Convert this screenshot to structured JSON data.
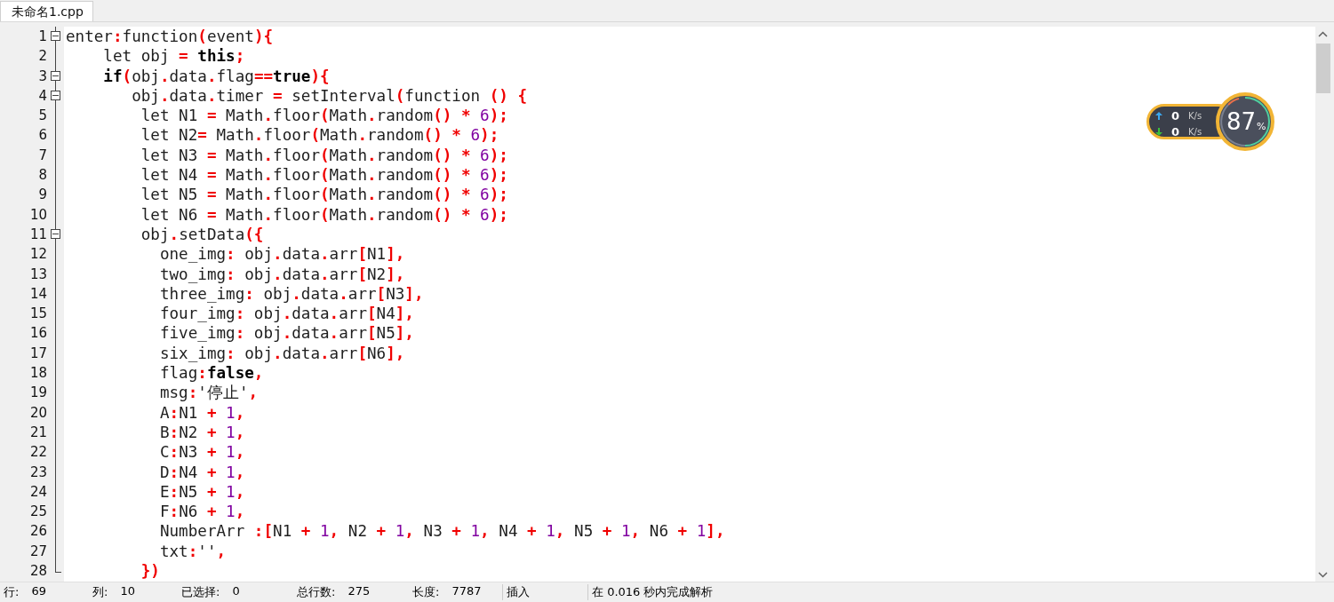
{
  "tabs": [
    {
      "label": "未命名1.cpp",
      "selected": true
    }
  ],
  "editor": {
    "lines": [
      {
        "number": "1",
        "fold_start": true,
        "tokens": [
          {
            "kind": "text",
            "text": "enter"
          },
          {
            "kind": "op",
            "text": ":"
          },
          {
            "kind": "text",
            "text": "function"
          },
          {
            "kind": "op",
            "text": "("
          },
          {
            "kind": "text",
            "text": "event"
          },
          {
            "kind": "op",
            "text": "){"
          }
        ]
      },
      {
        "number": "2",
        "tokens": [
          {
            "kind": "text",
            "text": "    let obj "
          },
          {
            "kind": "op",
            "text": "= "
          },
          {
            "kind": "keyword",
            "text": "this"
          },
          {
            "kind": "op",
            "text": ";"
          }
        ]
      },
      {
        "number": "3",
        "fold_start": true,
        "tokens": [
          {
            "kind": "keyword",
            "text": "    if"
          },
          {
            "kind": "op",
            "text": "("
          },
          {
            "kind": "text",
            "text": "obj"
          },
          {
            "kind": "op",
            "text": "."
          },
          {
            "kind": "text",
            "text": "data"
          },
          {
            "kind": "op",
            "text": "."
          },
          {
            "kind": "text",
            "text": "flag"
          },
          {
            "kind": "op",
            "text": "=="
          },
          {
            "kind": "keyword",
            "text": "true"
          },
          {
            "kind": "op",
            "text": "){"
          }
        ]
      },
      {
        "number": "4",
        "fold_start": true,
        "tokens": [
          {
            "kind": "text",
            "text": "       obj"
          },
          {
            "kind": "op",
            "text": "."
          },
          {
            "kind": "text",
            "text": "data"
          },
          {
            "kind": "op",
            "text": "."
          },
          {
            "kind": "text",
            "text": "timer "
          },
          {
            "kind": "op",
            "text": "="
          },
          {
            "kind": "text",
            "text": " setInterval"
          },
          {
            "kind": "op",
            "text": "("
          },
          {
            "kind": "text",
            "text": "function "
          },
          {
            "kind": "op",
            "text": "() {"
          }
        ]
      },
      {
        "number": "5",
        "tokens": [
          {
            "kind": "text",
            "text": "        let N1 "
          },
          {
            "kind": "op",
            "text": "="
          },
          {
            "kind": "text",
            "text": " Math"
          },
          {
            "kind": "op",
            "text": "."
          },
          {
            "kind": "text",
            "text": "floor"
          },
          {
            "kind": "op",
            "text": "("
          },
          {
            "kind": "text",
            "text": "Math"
          },
          {
            "kind": "op",
            "text": "."
          },
          {
            "kind": "text",
            "text": "random"
          },
          {
            "kind": "op",
            "text": "() * "
          },
          {
            "kind": "number",
            "text": "6"
          },
          {
            "kind": "op",
            "text": ");"
          }
        ]
      },
      {
        "number": "6",
        "tokens": [
          {
            "kind": "text",
            "text": "        let N2"
          },
          {
            "kind": "op",
            "text": "="
          },
          {
            "kind": "text",
            "text": " Math"
          },
          {
            "kind": "op",
            "text": "."
          },
          {
            "kind": "text",
            "text": "floor"
          },
          {
            "kind": "op",
            "text": "("
          },
          {
            "kind": "text",
            "text": "Math"
          },
          {
            "kind": "op",
            "text": "."
          },
          {
            "kind": "text",
            "text": "random"
          },
          {
            "kind": "op",
            "text": "() * "
          },
          {
            "kind": "number",
            "text": "6"
          },
          {
            "kind": "op",
            "text": ");"
          }
        ]
      },
      {
        "number": "7",
        "tokens": [
          {
            "kind": "text",
            "text": "        let N3 "
          },
          {
            "kind": "op",
            "text": "="
          },
          {
            "kind": "text",
            "text": " Math"
          },
          {
            "kind": "op",
            "text": "."
          },
          {
            "kind": "text",
            "text": "floor"
          },
          {
            "kind": "op",
            "text": "("
          },
          {
            "kind": "text",
            "text": "Math"
          },
          {
            "kind": "op",
            "text": "."
          },
          {
            "kind": "text",
            "text": "random"
          },
          {
            "kind": "op",
            "text": "() * "
          },
          {
            "kind": "number",
            "text": "6"
          },
          {
            "kind": "op",
            "text": ");"
          }
        ]
      },
      {
        "number": "8",
        "tokens": [
          {
            "kind": "text",
            "text": "        let N4 "
          },
          {
            "kind": "op",
            "text": "="
          },
          {
            "kind": "text",
            "text": " Math"
          },
          {
            "kind": "op",
            "text": "."
          },
          {
            "kind": "text",
            "text": "floor"
          },
          {
            "kind": "op",
            "text": "("
          },
          {
            "kind": "text",
            "text": "Math"
          },
          {
            "kind": "op",
            "text": "."
          },
          {
            "kind": "text",
            "text": "random"
          },
          {
            "kind": "op",
            "text": "() * "
          },
          {
            "kind": "number",
            "text": "6"
          },
          {
            "kind": "op",
            "text": ");"
          }
        ]
      },
      {
        "number": "9",
        "tokens": [
          {
            "kind": "text",
            "text": "        let N5 "
          },
          {
            "kind": "op",
            "text": "="
          },
          {
            "kind": "text",
            "text": " Math"
          },
          {
            "kind": "op",
            "text": "."
          },
          {
            "kind": "text",
            "text": "floor"
          },
          {
            "kind": "op",
            "text": "("
          },
          {
            "kind": "text",
            "text": "Math"
          },
          {
            "kind": "op",
            "text": "."
          },
          {
            "kind": "text",
            "text": "random"
          },
          {
            "kind": "op",
            "text": "() * "
          },
          {
            "kind": "number",
            "text": "6"
          },
          {
            "kind": "op",
            "text": ");"
          }
        ]
      },
      {
        "number": "10",
        "tokens": [
          {
            "kind": "text",
            "text": "        let N6 "
          },
          {
            "kind": "op",
            "text": "="
          },
          {
            "kind": "text",
            "text": " Math"
          },
          {
            "kind": "op",
            "text": "."
          },
          {
            "kind": "text",
            "text": "floor"
          },
          {
            "kind": "op",
            "text": "("
          },
          {
            "kind": "text",
            "text": "Math"
          },
          {
            "kind": "op",
            "text": "."
          },
          {
            "kind": "text",
            "text": "random"
          },
          {
            "kind": "op",
            "text": "() * "
          },
          {
            "kind": "number",
            "text": "6"
          },
          {
            "kind": "op",
            "text": ");"
          }
        ]
      },
      {
        "number": "11",
        "fold_start": true,
        "tokens": [
          {
            "kind": "text",
            "text": "        obj"
          },
          {
            "kind": "op",
            "text": "."
          },
          {
            "kind": "text",
            "text": "setData"
          },
          {
            "kind": "op",
            "text": "({"
          }
        ]
      },
      {
        "number": "12",
        "tokens": [
          {
            "kind": "text",
            "text": "          one_img"
          },
          {
            "kind": "op",
            "text": ":"
          },
          {
            "kind": "text",
            "text": " obj"
          },
          {
            "kind": "op",
            "text": "."
          },
          {
            "kind": "text",
            "text": "data"
          },
          {
            "kind": "op",
            "text": "."
          },
          {
            "kind": "text",
            "text": "arr"
          },
          {
            "kind": "op",
            "text": "["
          },
          {
            "kind": "text",
            "text": "N1"
          },
          {
            "kind": "op",
            "text": "],"
          }
        ]
      },
      {
        "number": "13",
        "tokens": [
          {
            "kind": "text",
            "text": "          two_img"
          },
          {
            "kind": "op",
            "text": ":"
          },
          {
            "kind": "text",
            "text": " obj"
          },
          {
            "kind": "op",
            "text": "."
          },
          {
            "kind": "text",
            "text": "data"
          },
          {
            "kind": "op",
            "text": "."
          },
          {
            "kind": "text",
            "text": "arr"
          },
          {
            "kind": "op",
            "text": "["
          },
          {
            "kind": "text",
            "text": "N2"
          },
          {
            "kind": "op",
            "text": "],"
          }
        ]
      },
      {
        "number": "14",
        "tokens": [
          {
            "kind": "text",
            "text": "          three_img"
          },
          {
            "kind": "op",
            "text": ":"
          },
          {
            "kind": "text",
            "text": " obj"
          },
          {
            "kind": "op",
            "text": "."
          },
          {
            "kind": "text",
            "text": "data"
          },
          {
            "kind": "op",
            "text": "."
          },
          {
            "kind": "text",
            "text": "arr"
          },
          {
            "kind": "op",
            "text": "["
          },
          {
            "kind": "text",
            "text": "N3"
          },
          {
            "kind": "op",
            "text": "],"
          }
        ]
      },
      {
        "number": "15",
        "tokens": [
          {
            "kind": "text",
            "text": "          four_img"
          },
          {
            "kind": "op",
            "text": ":"
          },
          {
            "kind": "text",
            "text": " obj"
          },
          {
            "kind": "op",
            "text": "."
          },
          {
            "kind": "text",
            "text": "data"
          },
          {
            "kind": "op",
            "text": "."
          },
          {
            "kind": "text",
            "text": "arr"
          },
          {
            "kind": "op",
            "text": "["
          },
          {
            "kind": "text",
            "text": "N4"
          },
          {
            "kind": "op",
            "text": "],"
          }
        ]
      },
      {
        "number": "16",
        "tokens": [
          {
            "kind": "text",
            "text": "          five_img"
          },
          {
            "kind": "op",
            "text": ":"
          },
          {
            "kind": "text",
            "text": " obj"
          },
          {
            "kind": "op",
            "text": "."
          },
          {
            "kind": "text",
            "text": "data"
          },
          {
            "kind": "op",
            "text": "."
          },
          {
            "kind": "text",
            "text": "arr"
          },
          {
            "kind": "op",
            "text": "["
          },
          {
            "kind": "text",
            "text": "N5"
          },
          {
            "kind": "op",
            "text": "],"
          }
        ]
      },
      {
        "number": "17",
        "tokens": [
          {
            "kind": "text",
            "text": "          six_img"
          },
          {
            "kind": "op",
            "text": ":"
          },
          {
            "kind": "text",
            "text": " obj"
          },
          {
            "kind": "op",
            "text": "."
          },
          {
            "kind": "text",
            "text": "data"
          },
          {
            "kind": "op",
            "text": "."
          },
          {
            "kind": "text",
            "text": "arr"
          },
          {
            "kind": "op",
            "text": "["
          },
          {
            "kind": "text",
            "text": "N6"
          },
          {
            "kind": "op",
            "text": "],"
          }
        ]
      },
      {
        "number": "18",
        "tokens": [
          {
            "kind": "text",
            "text": "          flag"
          },
          {
            "kind": "op",
            "text": ":"
          },
          {
            "kind": "keyword",
            "text": "false"
          },
          {
            "kind": "op",
            "text": ","
          }
        ]
      },
      {
        "number": "19",
        "tokens": [
          {
            "kind": "text",
            "text": "          msg"
          },
          {
            "kind": "op",
            "text": ":"
          },
          {
            "kind": "text",
            "text": "'停止'"
          },
          {
            "kind": "op",
            "text": ","
          }
        ]
      },
      {
        "number": "20",
        "tokens": [
          {
            "kind": "text",
            "text": "          A"
          },
          {
            "kind": "op",
            "text": ":"
          },
          {
            "kind": "text",
            "text": "N1 "
          },
          {
            "kind": "op",
            "text": "+ "
          },
          {
            "kind": "number",
            "text": "1"
          },
          {
            "kind": "op",
            "text": ","
          }
        ]
      },
      {
        "number": "21",
        "tokens": [
          {
            "kind": "text",
            "text": "          B"
          },
          {
            "kind": "op",
            "text": ":"
          },
          {
            "kind": "text",
            "text": "N2 "
          },
          {
            "kind": "op",
            "text": "+ "
          },
          {
            "kind": "number",
            "text": "1"
          },
          {
            "kind": "op",
            "text": ","
          }
        ]
      },
      {
        "number": "22",
        "tokens": [
          {
            "kind": "text",
            "text": "          C"
          },
          {
            "kind": "op",
            "text": ":"
          },
          {
            "kind": "text",
            "text": "N3 "
          },
          {
            "kind": "op",
            "text": "+ "
          },
          {
            "kind": "number",
            "text": "1"
          },
          {
            "kind": "op",
            "text": ","
          }
        ]
      },
      {
        "number": "23",
        "tokens": [
          {
            "kind": "text",
            "text": "          D"
          },
          {
            "kind": "op",
            "text": ":"
          },
          {
            "kind": "text",
            "text": "N4 "
          },
          {
            "kind": "op",
            "text": "+ "
          },
          {
            "kind": "number",
            "text": "1"
          },
          {
            "kind": "op",
            "text": ","
          }
        ]
      },
      {
        "number": "24",
        "tokens": [
          {
            "kind": "text",
            "text": "          E"
          },
          {
            "kind": "op",
            "text": ":"
          },
          {
            "kind": "text",
            "text": "N5 "
          },
          {
            "kind": "op",
            "text": "+ "
          },
          {
            "kind": "number",
            "text": "1"
          },
          {
            "kind": "op",
            "text": ","
          }
        ]
      },
      {
        "number": "25",
        "tokens": [
          {
            "kind": "text",
            "text": "          F"
          },
          {
            "kind": "op",
            "text": ":"
          },
          {
            "kind": "text",
            "text": "N6 "
          },
          {
            "kind": "op",
            "text": "+ "
          },
          {
            "kind": "number",
            "text": "1"
          },
          {
            "kind": "op",
            "text": ","
          }
        ]
      },
      {
        "number": "26",
        "tokens": [
          {
            "kind": "text",
            "text": "          NumberArr "
          },
          {
            "kind": "op",
            "text": ":["
          },
          {
            "kind": "text",
            "text": "N1 "
          },
          {
            "kind": "op",
            "text": "+ "
          },
          {
            "kind": "number",
            "text": "1"
          },
          {
            "kind": "op",
            "text": ","
          },
          {
            "kind": "text",
            "text": " N2 "
          },
          {
            "kind": "op",
            "text": "+ "
          },
          {
            "kind": "number",
            "text": "1"
          },
          {
            "kind": "op",
            "text": ","
          },
          {
            "kind": "text",
            "text": " N3 "
          },
          {
            "kind": "op",
            "text": "+ "
          },
          {
            "kind": "number",
            "text": "1"
          },
          {
            "kind": "op",
            "text": ","
          },
          {
            "kind": "text",
            "text": " N4 "
          },
          {
            "kind": "op",
            "text": "+ "
          },
          {
            "kind": "number",
            "text": "1"
          },
          {
            "kind": "op",
            "text": ","
          },
          {
            "kind": "text",
            "text": " N5 "
          },
          {
            "kind": "op",
            "text": "+ "
          },
          {
            "kind": "number",
            "text": "1"
          },
          {
            "kind": "op",
            "text": ","
          },
          {
            "kind": "text",
            "text": " N6 "
          },
          {
            "kind": "op",
            "text": "+ "
          },
          {
            "kind": "number",
            "text": "1"
          },
          {
            "kind": "op",
            "text": "],"
          }
        ]
      },
      {
        "number": "27",
        "tokens": [
          {
            "kind": "text",
            "text": "          txt"
          },
          {
            "kind": "op",
            "text": ":"
          },
          {
            "kind": "text",
            "text": "''"
          },
          {
            "kind": "op",
            "text": ","
          }
        ]
      },
      {
        "number": "28",
        "fold_end": true,
        "tokens": [
          {
            "kind": "op",
            "text": "        })"
          }
        ]
      }
    ]
  },
  "speed_widget": {
    "upload": {
      "value": "0",
      "unit": "K/s"
    },
    "download": {
      "value": "0",
      "unit": "K/s"
    },
    "usage": {
      "value": "87",
      "unit": "%"
    }
  },
  "status_bar": [
    {
      "label": "行:",
      "value": "69"
    },
    {
      "label": "列:",
      "value": "10"
    },
    {
      "label": "已选择:",
      "value": "0"
    },
    {
      "label": "总行数:",
      "value": "275"
    },
    {
      "label": "长度:",
      "value": "7787"
    },
    {
      "label": "插入"
    },
    {
      "label": "在 0.016 秒内完成解析"
    }
  ]
}
